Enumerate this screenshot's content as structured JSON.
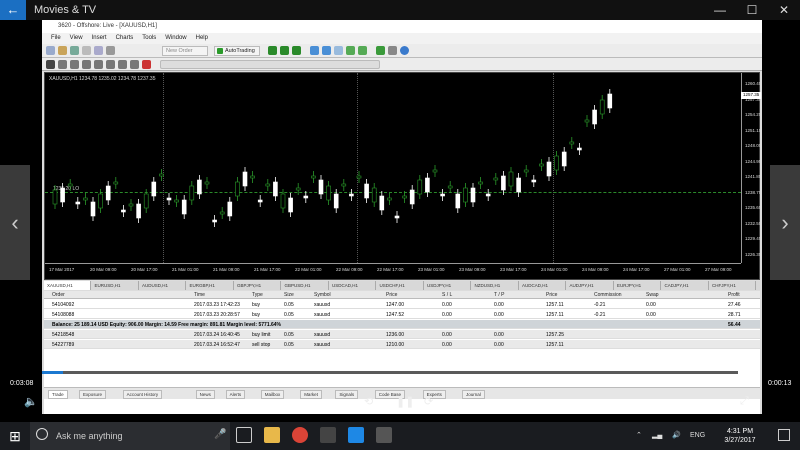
{
  "app": {
    "title": "Movies & TV",
    "back_glyph": "←",
    "window_controls": {
      "minimize": "—",
      "maximize": "☐",
      "close": "✕"
    }
  },
  "side_arrows": {
    "prev": "‹",
    "next": "›"
  },
  "mt4": {
    "title": "3620 - Offshore: Live - [XAUUSD,H1]",
    "menu": [
      "File",
      "View",
      "Insert",
      "Charts",
      "Tools",
      "Window",
      "Help"
    ],
    "autotrading_label": "AutoTrading",
    "new_order_label": "New Order",
    "chart_label": "XAUUSD,H1  1234.78 1235.02 1234.78 1237.35",
    "bid_label": "1235.20 LO",
    "current_price": "1257.35",
    "price_ticks": [
      "1260.45",
      "1257.35",
      "1254.25",
      "1251.15",
      "1248.05",
      "1244.95",
      "1241.85",
      "1238.75",
      "1235.65",
      "1232.55",
      "1229.45",
      "1226.35"
    ],
    "time_ticks": [
      "17 Mar 2017",
      "20 Mar 09:00",
      "20 Mar 17:00",
      "21 Mar 01:00",
      "21 Mar 09:00",
      "21 Mar 17:00",
      "22 Mar 01:00",
      "22 Mar 09:00",
      "22 Mar 17:00",
      "23 Mar 01:00",
      "23 Mar 09:00",
      "23 Mar 17:00",
      "24 Mar 01:00",
      "24 Mar 09:00",
      "24 Mar 17:00",
      "27 Mar 01:00",
      "27 Mar 09:00"
    ],
    "symbol_tabs": [
      "XAUUSD,H1",
      "EURUSD,H1",
      "AUDUSD,H1",
      "EURGBP,H1",
      "GBPJPY,H1",
      "GBPUSD,H1",
      "USDCAD,H1",
      "USDCHF,H1",
      "USDJPY,H1",
      "NZDUSD,H1",
      "AUDCAD,H1",
      "AUDJPY,H1",
      "EURJPY,H1",
      "CADJPY,H1",
      "CHFJPY,H1"
    ],
    "terminal": {
      "columns": [
        "Order",
        "Time",
        "Type",
        "Size",
        "Symbol",
        "Price",
        "S / L",
        "T / P",
        "Price",
        "Commission",
        "Swap",
        "Profit"
      ],
      "rows": [
        [
          "54104092",
          "2017.03.23 17:42:23",
          "buy",
          "0.05",
          "xauusd",
          "1247.00",
          "0.00",
          "0.00",
          "1257.11",
          "-0.21",
          "0.00",
          "27.46"
        ],
        [
          "54108088",
          "2017.03.23 20:28:57",
          "buy",
          "0.05",
          "xauusd",
          "1247.52",
          "0.00",
          "0.00",
          "1257.11",
          "-0.21",
          "0.00",
          "28.71"
        ]
      ],
      "balance": "Balance: 25 189.14 USD  Equity: 906.00  Margin: 14.59  Free margin: 891.81  Margin level: 5771.64%",
      "balance_profit": "56.44",
      "pending": [
        [
          "54218548",
          "2017.03.24 16:40:45",
          "buy limit",
          "0.05",
          "xauusd",
          "1236.00",
          "0.00",
          "0.00",
          "1257.25",
          "",
          ""
        ],
        [
          "54227789",
          "2017.03.24 16:52:47",
          "sell stop",
          "0.05",
          "xauusd",
          "1210.00",
          "0.00",
          "0.00",
          "1257.11",
          "",
          ""
        ]
      ],
      "tabs": [
        "Trade",
        "Exposure",
        "Account History",
        "News",
        "Alerts",
        "Mailbox",
        "Market",
        "Signals",
        "Code Base",
        "Experts",
        "Journal"
      ]
    }
  },
  "player": {
    "time_left": "0:03:08",
    "time_right": "0:00:13",
    "progress": 0.03
  },
  "taskbar": {
    "search_placeholder": "Ask me anything",
    "lang": "ENG",
    "time": "4:31 PM",
    "date": "3/27/2017"
  },
  "colors": {
    "bull": "#2a9a2a",
    "bear": "#ffffff",
    "accent": "#1b78d0"
  }
}
